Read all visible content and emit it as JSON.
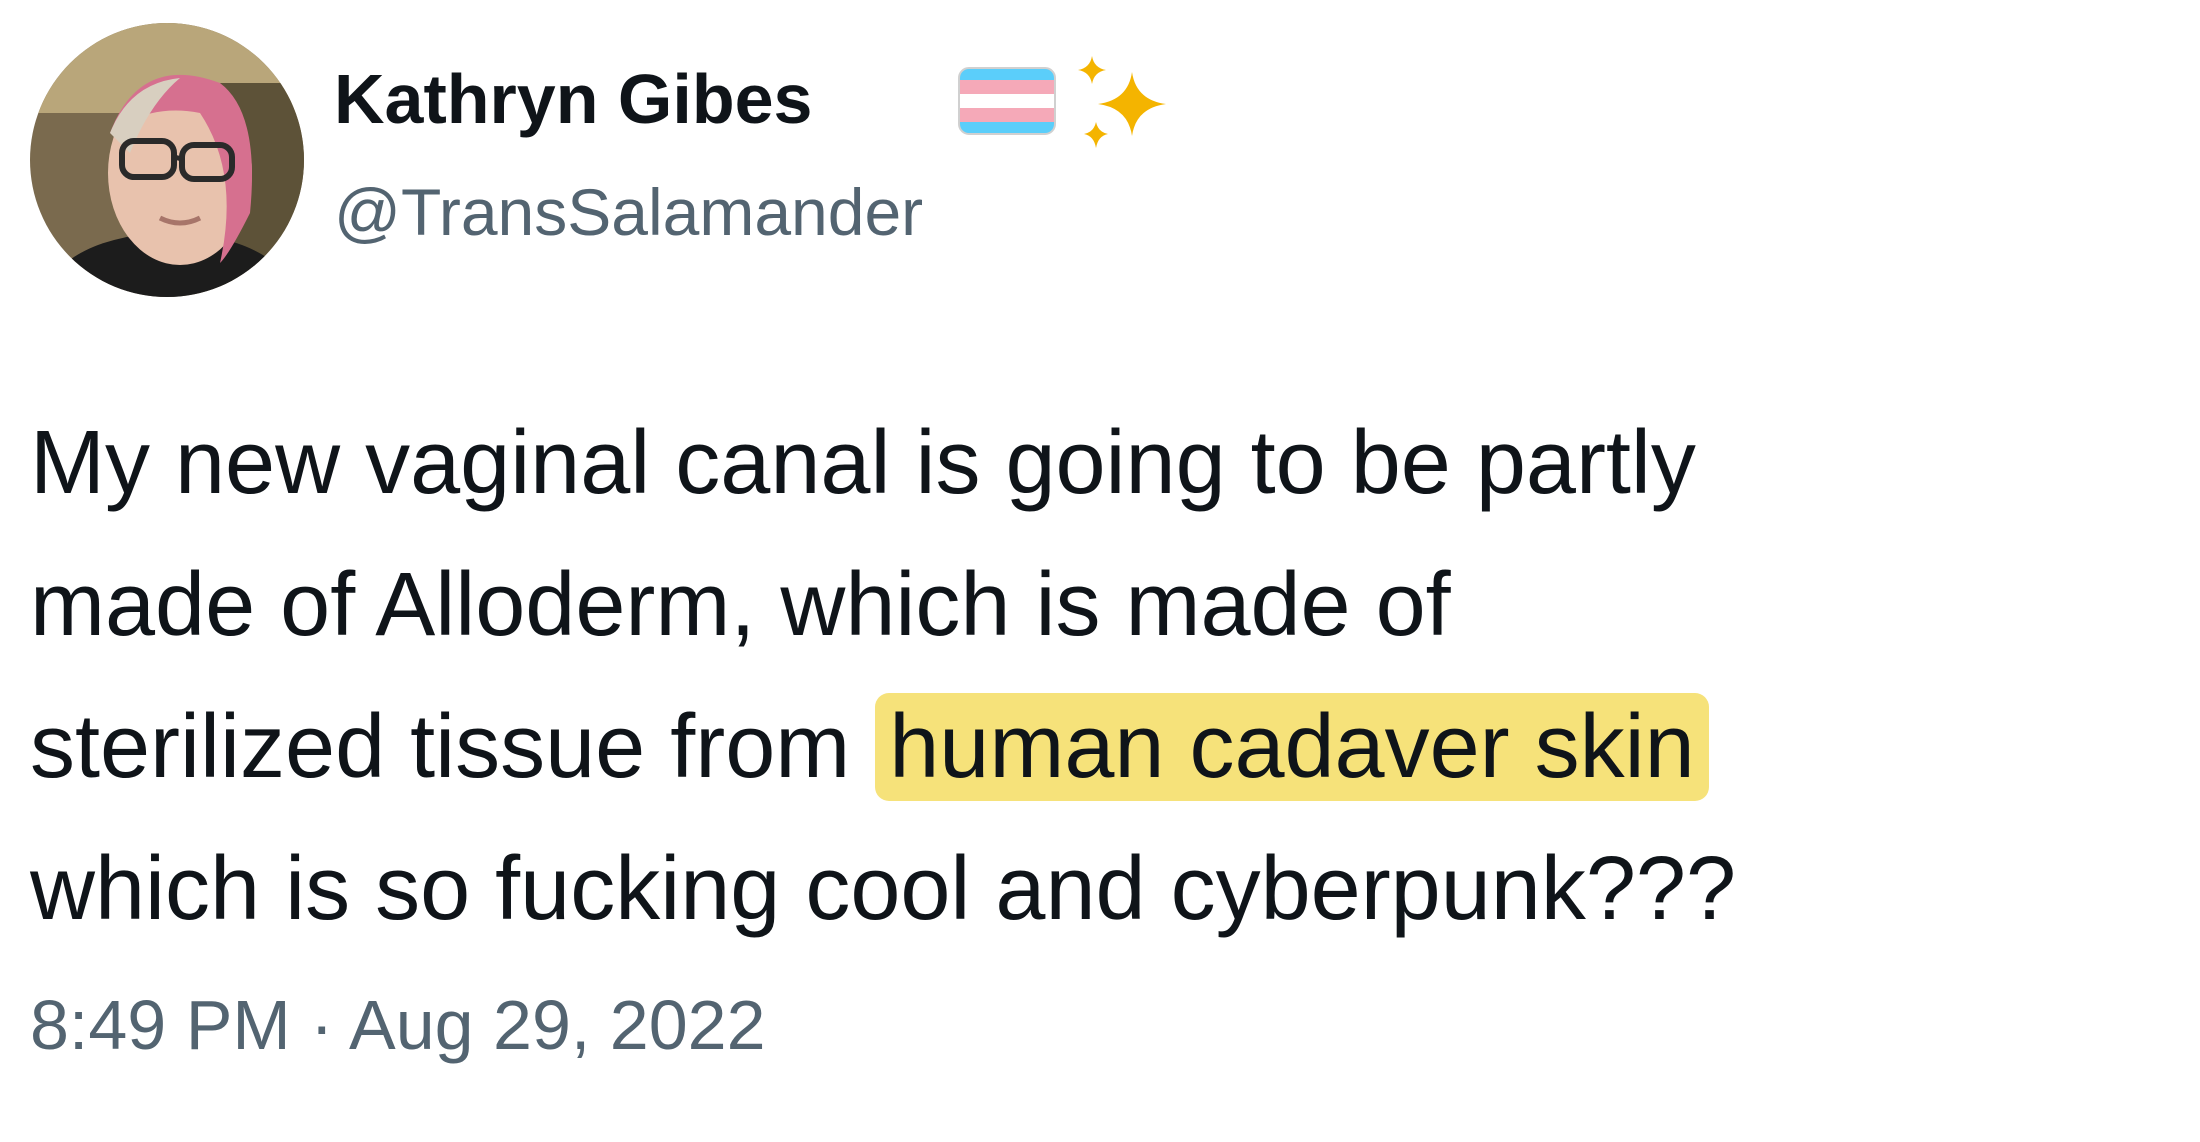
{
  "author": {
    "name": "Kathryn Gibes",
    "handle": "@TransSalamander",
    "name_icons": [
      "transgender-flag-icon",
      "sparkles-icon"
    ]
  },
  "tweet": {
    "lines": [
      "My new vaginal canal is going to be partly",
      "made of Alloderm, which is made of",
      "sterilized tissue from ",
      "which is so fucking cool and cyberpunk???"
    ],
    "highlighted_text": "human cadaver skin",
    "timestamp": "8:49 PM · Aug 29, 2022"
  },
  "colors": {
    "highlight": "#f6e27a",
    "secondary_text": "#536471",
    "flag_blue": "#5bcefa",
    "flag_pink": "#f5a9b8",
    "sparkle": "#f4b400"
  }
}
